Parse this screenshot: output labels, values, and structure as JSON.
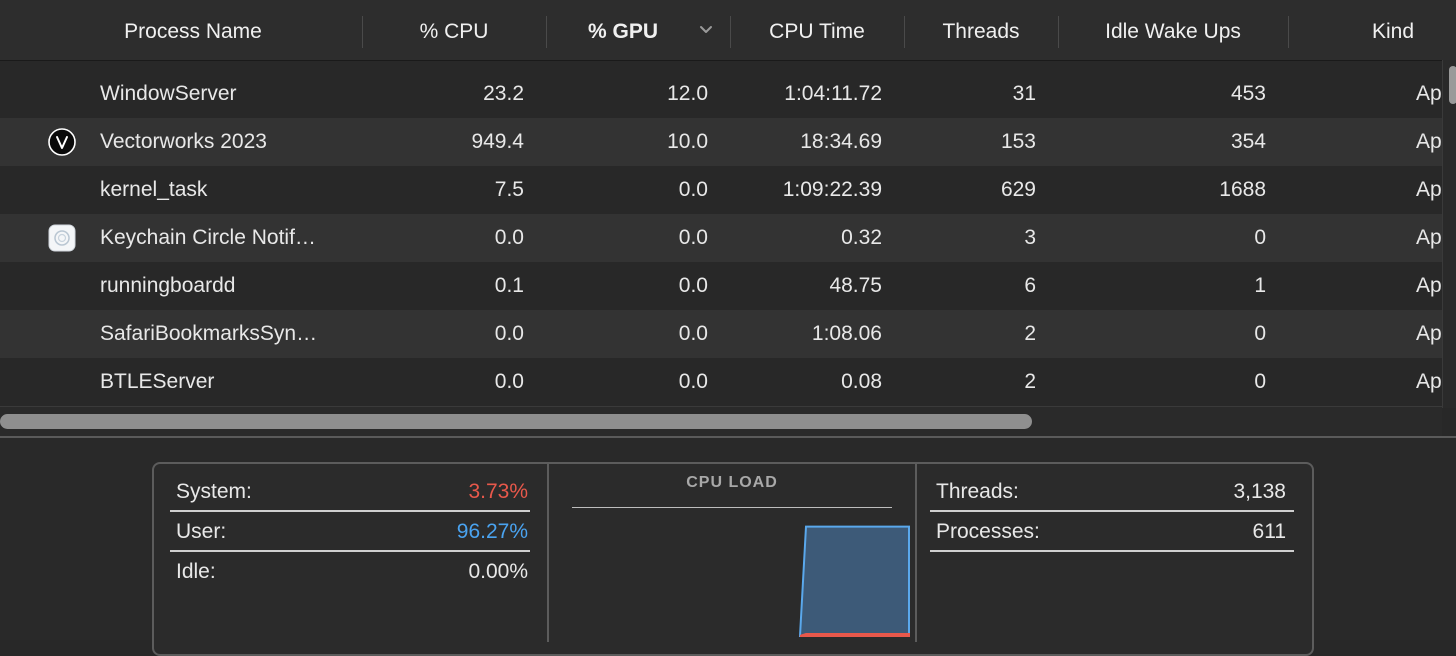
{
  "columns": {
    "process_name": "Process Name",
    "cpu": "% CPU",
    "gpu": "% GPU",
    "cpu_time": "CPU Time",
    "threads": "Threads",
    "idle_wake_ups": "Idle Wake Ups",
    "kind": "Kind"
  },
  "sorted_column": "% GPU",
  "rows": [
    {
      "name": "WindowServer",
      "cpu": "23.2",
      "gpu": "12.0",
      "cpu_time": "1:04:11.72",
      "threads": "31",
      "idle": "453",
      "kind": "Ap",
      "icon": ""
    },
    {
      "name": "Vectorworks 2023",
      "cpu": "949.4",
      "gpu": "10.0",
      "cpu_time": "18:34.69",
      "threads": "153",
      "idle": "354",
      "kind": "Ap",
      "icon": "vectorworks-icon"
    },
    {
      "name": "kernel_task",
      "cpu": "7.5",
      "gpu": "0.0",
      "cpu_time": "1:09:22.39",
      "threads": "629",
      "idle": "1688",
      "kind": "Ap",
      "icon": ""
    },
    {
      "name": "Keychain Circle Notif…",
      "cpu": "0.0",
      "gpu": "0.0",
      "cpu_time": "0.32",
      "threads": "3",
      "idle": "0",
      "kind": "Ap",
      "icon": "keychain-icon"
    },
    {
      "name": "runningboardd",
      "cpu": "0.1",
      "gpu": "0.0",
      "cpu_time": "48.75",
      "threads": "6",
      "idle": "1",
      "kind": "Ap",
      "icon": ""
    },
    {
      "name": "SafariBookmarksSyn…",
      "cpu": "0.0",
      "gpu": "0.0",
      "cpu_time": "1:08.06",
      "threads": "2",
      "idle": "0",
      "kind": "Ap",
      "icon": ""
    },
    {
      "name": "BTLEServer",
      "cpu": "0.0",
      "gpu": "0.0",
      "cpu_time": "0.08",
      "threads": "2",
      "idle": "0",
      "kind": "Ap",
      "icon": ""
    }
  ],
  "summary": {
    "system_label": "System:",
    "system_value": "3.73%",
    "user_label": "User:",
    "user_value": "96.27%",
    "idle_label": "Idle:",
    "idle_value": "0.00%",
    "cpu_load_title": "CPU LOAD",
    "threads_label": "Threads:",
    "threads_value": "3,138",
    "processes_label": "Processes:",
    "processes_value": "611"
  },
  "colors": {
    "system": "#e8584b",
    "user": "#4aa3f0",
    "graph_user_fill": "#3d5a78",
    "graph_user_line": "#5aa8ec",
    "graph_system": "#e8584b"
  },
  "cpu_load_graph": {
    "user_level": 0.96,
    "system_level": 0.04
  }
}
